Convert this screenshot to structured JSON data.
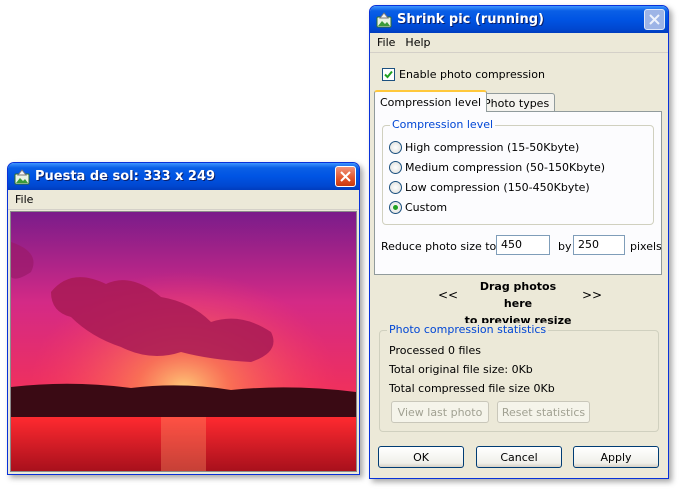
{
  "left_window": {
    "title": "Puesta de sol: 333 x 249",
    "menu": [
      "File"
    ]
  },
  "right_window": {
    "title": "Shrink pic (running)",
    "menu": [
      "File",
      "Help"
    ],
    "enable_compression": {
      "label": "Enable photo compression",
      "checked": true
    },
    "tabs": [
      {
        "label": "Compression level",
        "selected": true
      },
      {
        "label": "Photo types",
        "selected": false
      }
    ],
    "compression_group": {
      "legend": "Compression level",
      "options": [
        {
          "label": "High compression (15-50Kbyte)",
          "selected": false
        },
        {
          "label": "Medium compression (50-150Kbyte)",
          "selected": false
        },
        {
          "label": "Low compression (150-450Kbyte)",
          "selected": false
        },
        {
          "label": "Custom",
          "selected": true
        }
      ]
    },
    "resize": {
      "label": "Reduce photo size to",
      "width": "450",
      "by_label": "by",
      "height": "250",
      "unit_label": "pixels"
    },
    "drag_area": {
      "left_arrow": "<<",
      "line1": "Drag photos here",
      "line2": "to preview resize",
      "right_arrow": ">>"
    },
    "stats": {
      "legend": "Photo compression statistics",
      "processed": "Processed 0 files",
      "original_size": "Total original file size: 0Kb",
      "compressed_size": "Total compressed file size 0Kb",
      "view_last_label": "View last photo",
      "reset_label": "Reset statistics"
    },
    "buttons": {
      "ok": "OK",
      "cancel": "Cancel",
      "apply": "Apply"
    }
  },
  "colors": {
    "title_blue": "#0054e3",
    "dialog_bg": "#ece9d8",
    "legend_blue": "#0046d5",
    "tab_highlight": "#ffc83c"
  }
}
